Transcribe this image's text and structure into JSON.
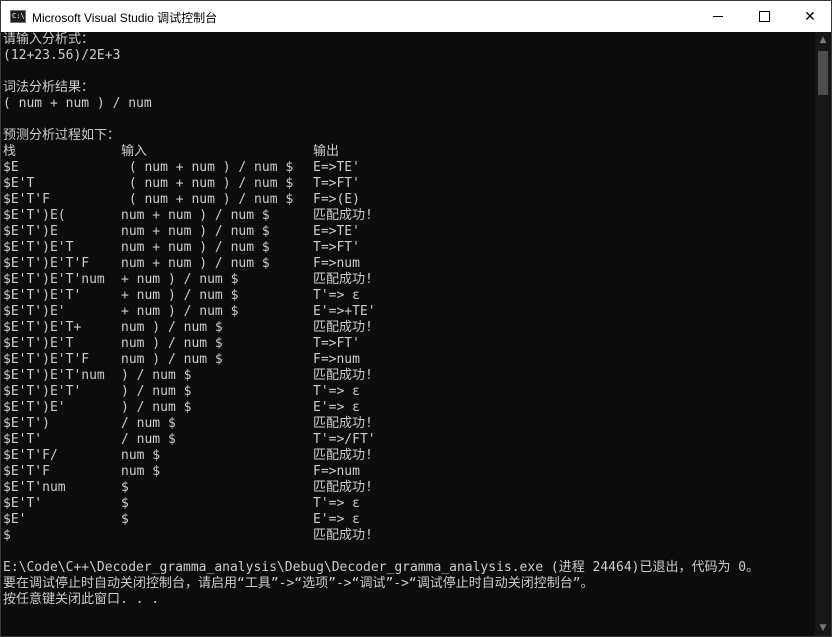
{
  "window": {
    "title": "Microsoft Visual Studio 调试控制台",
    "app_icon": "C:\\"
  },
  "controls": {
    "minimize": "minimize-icon",
    "maximize": "maximize-icon",
    "close": "close-icon"
  },
  "console": {
    "lines": [
      "请输入分析式：",
      "(12+23.56)/2E+3",
      "",
      "词法分析结果：",
      "( num + num ) / num",
      "",
      "预测分析过程如下："
    ],
    "header": {
      "stack": "栈",
      "input": "输入",
      "output": "输出"
    },
    "rows": [
      {
        "stack": "$E",
        "input": " ( num + num ) / num $",
        "output": "E=>TE'"
      },
      {
        "stack": "$E'T",
        "input": " ( num + num ) / num $",
        "output": "T=>FT'"
      },
      {
        "stack": "$E'T'F",
        "input": " ( num + num ) / num $",
        "output": "F=>(E)"
      },
      {
        "stack": "$E'T')E(",
        "input": "num + num ) / num $",
        "output": "匹配成功!"
      },
      {
        "stack": "$E'T')E",
        "input": "num + num ) / num $",
        "output": "E=>TE'"
      },
      {
        "stack": "$E'T')E'T",
        "input": "num + num ) / num $",
        "output": "T=>FT'"
      },
      {
        "stack": "$E'T')E'T'F",
        "input": "num + num ) / num $",
        "output": "F=>num"
      },
      {
        "stack": "$E'T')E'T'num",
        "input": "+ num ) / num $",
        "output": "匹配成功!"
      },
      {
        "stack": "$E'T')E'T'",
        "input": "+ num ) / num $",
        "output": "T'=> ε"
      },
      {
        "stack": "$E'T')E'",
        "input": "+ num ) / num $",
        "output": "E'=>+TE'"
      },
      {
        "stack": "$E'T')E'T+",
        "input": "num ) / num $",
        "output": "匹配成功!"
      },
      {
        "stack": "$E'T')E'T",
        "input": "num ) / num $",
        "output": "T=>FT'"
      },
      {
        "stack": "$E'T')E'T'F",
        "input": "num ) / num $",
        "output": "F=>num"
      },
      {
        "stack": "$E'T')E'T'num",
        "input": ") / num $",
        "output": "匹配成功!"
      },
      {
        "stack": "$E'T')E'T'",
        "input": ") / num $",
        "output": "T'=> ε"
      },
      {
        "stack": "$E'T')E'",
        "input": ") / num $",
        "output": "E'=> ε"
      },
      {
        "stack": "$E'T')",
        "input": "/ num $",
        "output": "匹配成功!"
      },
      {
        "stack": "$E'T'",
        "input": "/ num $",
        "output": "T'=>/FT'"
      },
      {
        "stack": "$E'T'F/",
        "input": "num $",
        "output": "匹配成功!"
      },
      {
        "stack": "$E'T'F",
        "input": "num $",
        "output": "F=>num"
      },
      {
        "stack": "$E'T'num",
        "input": "$",
        "output": "匹配成功!"
      },
      {
        "stack": "$E'T'",
        "input": "$",
        "output": "T'=> ε"
      },
      {
        "stack": "$E'",
        "input": "$",
        "output": "E'=> ε"
      },
      {
        "stack": "$",
        "input": "",
        "output": "匹配成功!"
      }
    ],
    "footer": [
      "",
      "E:\\Code\\C++\\Decoder_gramma_analysis\\Debug\\Decoder_gramma_analysis.exe (进程 24464)已退出，代码为 0。",
      "要在调试停止时自动关闭控制台，请启用“工具”->“选项”->“调试”->“调试停止时自动关闭控制台”。",
      "按任意键关闭此窗口. . ."
    ]
  }
}
